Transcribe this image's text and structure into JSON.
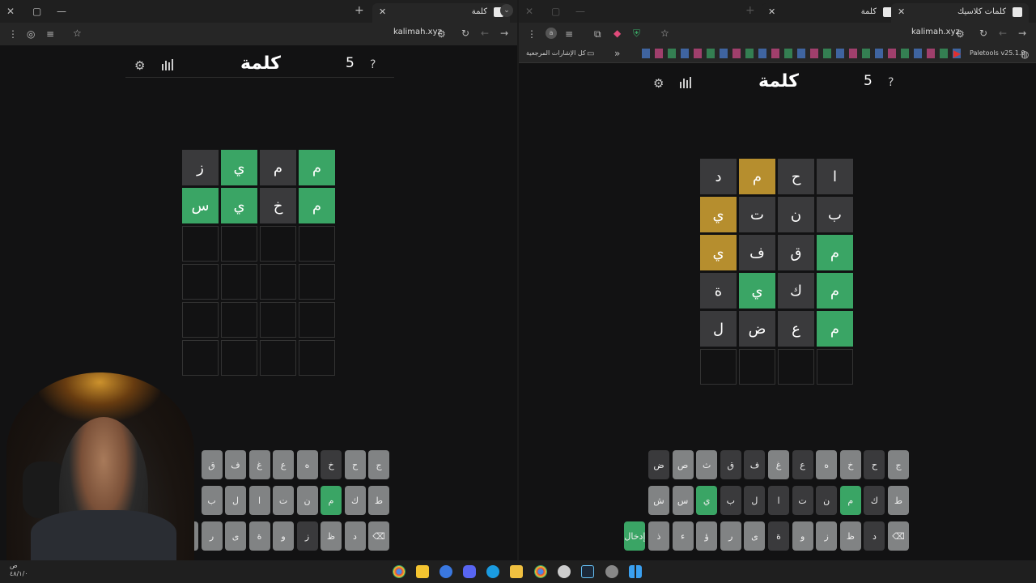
{
  "left_window": {
    "tab_title": "كلمة",
    "url": "kalimah.xyz",
    "game": {
      "title": "كلمة",
      "streak": "5",
      "board": [
        [
          {
            "l": "م",
            "s": "correct"
          },
          {
            "l": "م",
            "s": "absent"
          },
          {
            "l": "ي",
            "s": "correct"
          },
          {
            "l": "ز",
            "s": "absent"
          }
        ],
        [
          {
            "l": "م",
            "s": "correct"
          },
          {
            "l": "خ",
            "s": "absent"
          },
          {
            "l": "ي",
            "s": "correct"
          },
          {
            "l": "س",
            "s": "correct"
          }
        ],
        [
          {
            "l": "",
            "s": "empty"
          },
          {
            "l": "",
            "s": "empty"
          },
          {
            "l": "",
            "s": "empty"
          },
          {
            "l": "",
            "s": "empty"
          }
        ],
        [
          {
            "l": "",
            "s": "empty"
          },
          {
            "l": "",
            "s": "empty"
          },
          {
            "l": "",
            "s": "empty"
          },
          {
            "l": "",
            "s": "empty"
          }
        ],
        [
          {
            "l": "",
            "s": "empty"
          },
          {
            "l": "",
            "s": "empty"
          },
          {
            "l": "",
            "s": "empty"
          },
          {
            "l": "",
            "s": "empty"
          }
        ],
        [
          {
            "l": "",
            "s": "empty"
          },
          {
            "l": "",
            "s": "empty"
          },
          {
            "l": "",
            "s": "empty"
          },
          {
            "l": "",
            "s": "empty"
          }
        ]
      ],
      "keyboard": [
        [
          {
            "l": "ج",
            "s": "n"
          },
          {
            "l": "ح",
            "s": "n"
          },
          {
            "l": "خ",
            "s": "dark"
          },
          {
            "l": "ه",
            "s": "n"
          },
          {
            "l": "ع",
            "s": "n"
          },
          {
            "l": "غ",
            "s": "n"
          },
          {
            "l": "ف",
            "s": "n"
          },
          {
            "l": "ق",
            "s": "n"
          }
        ],
        [
          {
            "l": "ط",
            "s": "n"
          },
          {
            "l": "ك",
            "s": "n"
          },
          {
            "l": "م",
            "s": "green"
          },
          {
            "l": "ن",
            "s": "n"
          },
          {
            "l": "ت",
            "s": "n"
          },
          {
            "l": "ا",
            "s": "n"
          },
          {
            "l": "ل",
            "s": "n"
          },
          {
            "l": "ب",
            "s": "n"
          }
        ],
        [
          {
            "l": "⌫",
            "s": "n"
          },
          {
            "l": "د",
            "s": "n"
          },
          {
            "l": "ظ",
            "s": "n"
          },
          {
            "l": "ز",
            "s": "dark"
          },
          {
            "l": "و",
            "s": "n"
          },
          {
            "l": "ة",
            "s": "n"
          },
          {
            "l": "ى",
            "s": "n"
          },
          {
            "l": "ر",
            "s": "n"
          },
          {
            "l": "ؤ",
            "s": "n"
          }
        ]
      ]
    }
  },
  "right_window": {
    "tab_title": "كلمة",
    "tab2_title": "كلمات كلاسيك",
    "url": "kalimah.xyz",
    "bookmarks_folder": "كل الإشارات المرجعية",
    "paletools_label": "Paletools v25.1.9",
    "game": {
      "title": "كلمة",
      "streak": "5",
      "board": [
        [
          {
            "l": "ا",
            "s": "absent"
          },
          {
            "l": "ح",
            "s": "absent"
          },
          {
            "l": "م",
            "s": "present"
          },
          {
            "l": "د",
            "s": "absent"
          }
        ],
        [
          {
            "l": "ب",
            "s": "absent"
          },
          {
            "l": "ن",
            "s": "absent"
          },
          {
            "l": "ت",
            "s": "absent"
          },
          {
            "l": "ي",
            "s": "present"
          }
        ],
        [
          {
            "l": "م",
            "s": "correct"
          },
          {
            "l": "ق",
            "s": "absent"
          },
          {
            "l": "ف",
            "s": "absent"
          },
          {
            "l": "ي",
            "s": "present"
          }
        ],
        [
          {
            "l": "م",
            "s": "correct"
          },
          {
            "l": "ك",
            "s": "absent"
          },
          {
            "l": "ي",
            "s": "correct"
          },
          {
            "l": "ة",
            "s": "absent"
          }
        ],
        [
          {
            "l": "م",
            "s": "correct"
          },
          {
            "l": "ع",
            "s": "absent"
          },
          {
            "l": "ض",
            "s": "absent"
          },
          {
            "l": "ل",
            "s": "absent"
          }
        ],
        [
          {
            "l": "",
            "s": "empty"
          },
          {
            "l": "",
            "s": "empty"
          },
          {
            "l": "",
            "s": "empty"
          },
          {
            "l": "",
            "s": "empty"
          }
        ]
      ],
      "keyboard": [
        [
          {
            "l": "ج",
            "s": "n"
          },
          {
            "l": "ح",
            "s": "dark"
          },
          {
            "l": "خ",
            "s": "n"
          },
          {
            "l": "ه",
            "s": "n"
          },
          {
            "l": "ع",
            "s": "dark"
          },
          {
            "l": "غ",
            "s": "n"
          },
          {
            "l": "ف",
            "s": "dark"
          },
          {
            "l": "ق",
            "s": "dark"
          },
          {
            "l": "ث",
            "s": "n"
          },
          {
            "l": "ص",
            "s": "n"
          },
          {
            "l": "ض",
            "s": "dark"
          }
        ],
        [
          {
            "l": "ط",
            "s": "n"
          },
          {
            "l": "ك",
            "s": "dark"
          },
          {
            "l": "م",
            "s": "green"
          },
          {
            "l": "ن",
            "s": "dark"
          },
          {
            "l": "ت",
            "s": "dark"
          },
          {
            "l": "ا",
            "s": "dark"
          },
          {
            "l": "ل",
            "s": "dark"
          },
          {
            "l": "ب",
            "s": "dark"
          },
          {
            "l": "ي",
            "s": "green"
          },
          {
            "l": "س",
            "s": "n"
          },
          {
            "l": "ش",
            "s": "n"
          }
        ],
        [
          {
            "l": "⌫",
            "s": "n"
          },
          {
            "l": "د",
            "s": "dark"
          },
          {
            "l": "ظ",
            "s": "n"
          },
          {
            "l": "ز",
            "s": "n"
          },
          {
            "l": "و",
            "s": "n"
          },
          {
            "l": "ة",
            "s": "dark"
          },
          {
            "l": "ى",
            "s": "n"
          },
          {
            "l": "ر",
            "s": "n"
          },
          {
            "l": "ؤ",
            "s": "n"
          },
          {
            "l": "ء",
            "s": "n"
          },
          {
            "l": "ذ",
            "s": "n"
          },
          {
            "l": "إدخال",
            "s": "green"
          }
        ]
      ]
    }
  },
  "taskbar": {
    "clock": "ص ٤٨/١/٠"
  },
  "colors": {
    "correct": "#3aa565",
    "present": "#b68e2e",
    "absent": "#3a3a3c",
    "key": "#818384"
  }
}
